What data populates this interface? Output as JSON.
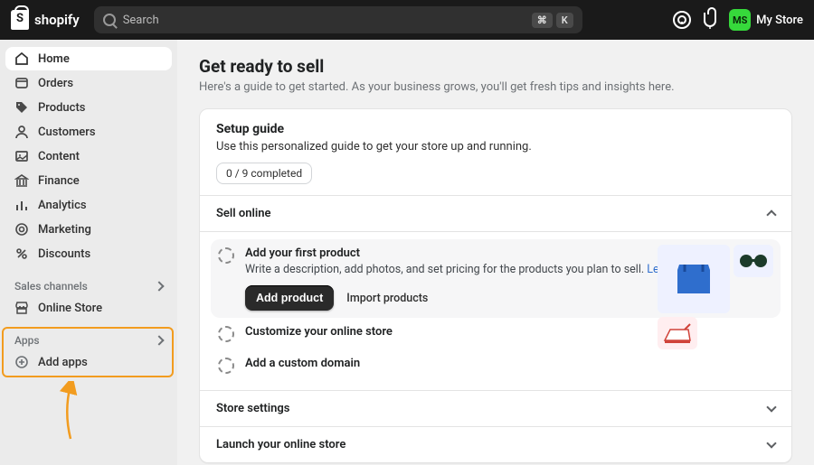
{
  "brand": "shopify",
  "search": {
    "placeholder": "Search",
    "kbd1": "⌘",
    "kbd2": "K"
  },
  "store": {
    "initials": "MS",
    "name": "My Store"
  },
  "nav": {
    "home": "Home",
    "orders": "Orders",
    "products": "Products",
    "customers": "Customers",
    "content": "Content",
    "finance": "Finance",
    "analytics": "Analytics",
    "marketing": "Marketing",
    "discounts": "Discounts"
  },
  "channels": {
    "header": "Sales channels",
    "online_store": "Online Store"
  },
  "apps": {
    "header": "Apps",
    "add": "Add apps"
  },
  "page": {
    "title": "Get ready to sell",
    "subtitle": "Here's a guide to get started. As your business grows, you'll get fresh tips and insights here."
  },
  "setup": {
    "title": "Setup guide",
    "desc": "Use this personalized guide to get your store up and running.",
    "progress": "0 / 9 completed",
    "sections": {
      "sell_online": "Sell online",
      "store_settings": "Store settings",
      "launch": "Launch your online store"
    },
    "tasks": {
      "first_product": {
        "title": "Add your first product",
        "desc": "Write a description, add photos, and set pricing for the products you plan to sell. ",
        "learn": "Learn more",
        "primary": "Add product",
        "secondary": "Import products"
      },
      "customize": "Customize your online store",
      "domain": "Add a custom domain"
    }
  }
}
